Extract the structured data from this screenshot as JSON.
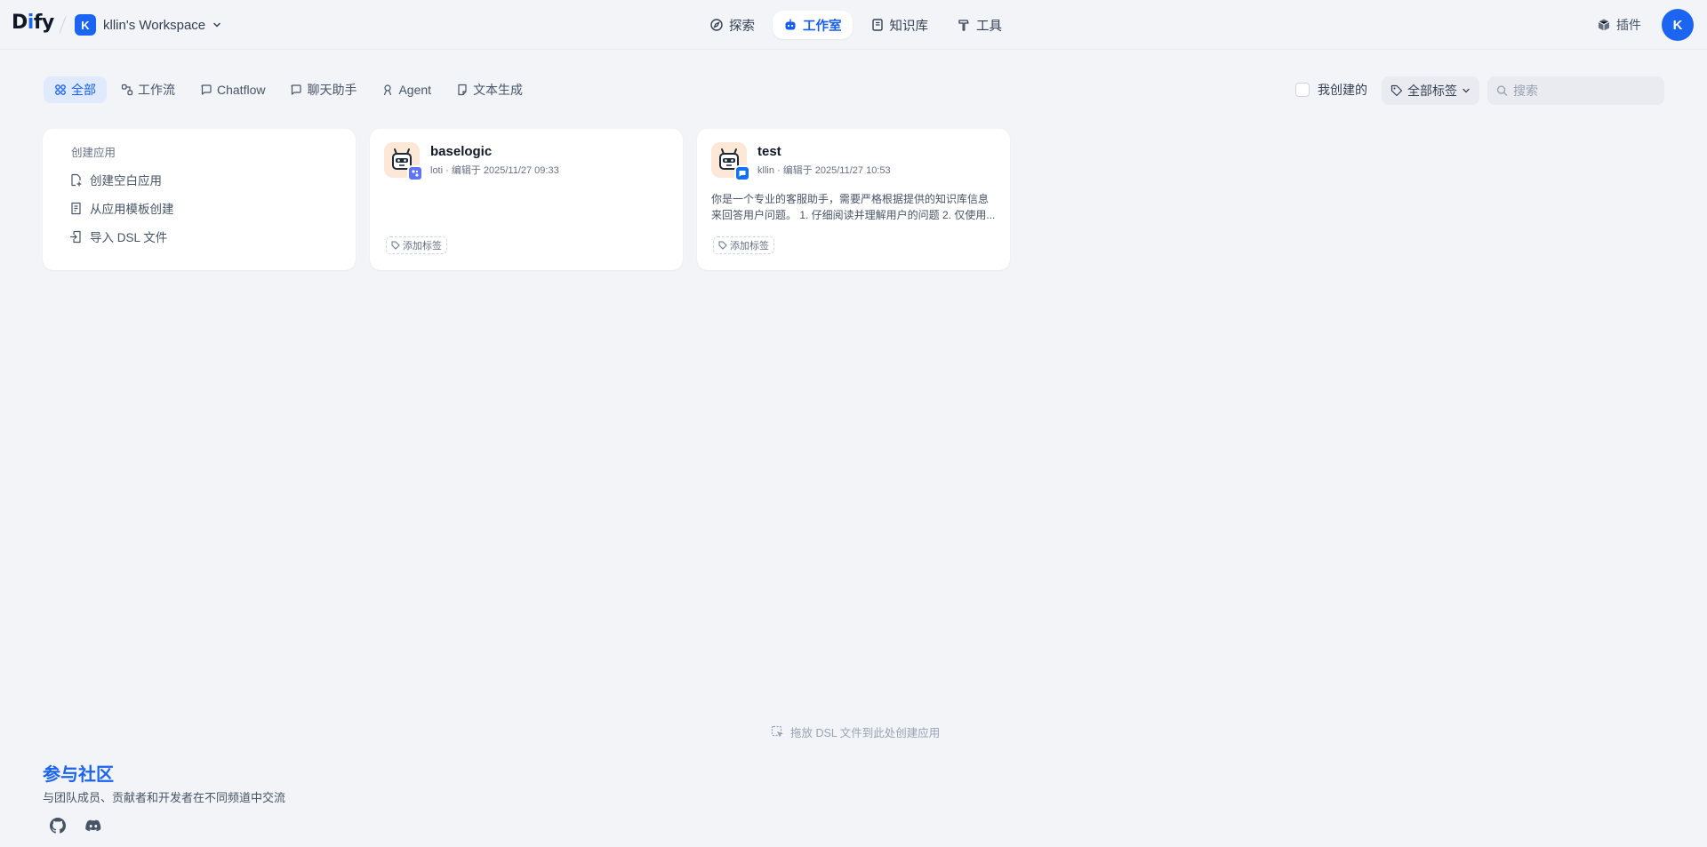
{
  "header": {
    "logo_text": "Dify",
    "workspace": {
      "initial": "K",
      "name": "kllin's Workspace"
    },
    "nav": [
      {
        "label": "探索",
        "icon": "compass-icon"
      },
      {
        "label": "工作室",
        "icon": "robot-icon",
        "active": true
      },
      {
        "label": "知识库",
        "icon": "book-icon"
      },
      {
        "label": "工具",
        "icon": "hammer-icon"
      }
    ],
    "plugin_label": "插件",
    "user_initial": "K"
  },
  "filters": {
    "tabs": [
      {
        "label": "全部",
        "icon": "grid-icon",
        "active": true
      },
      {
        "label": "工作流",
        "icon": "workflow-icon"
      },
      {
        "label": "Chatflow",
        "icon": "chat-bubble-icon"
      },
      {
        "label": "聊天助手",
        "icon": "chat-bubble-icon"
      },
      {
        "label": "Agent",
        "icon": "agent-icon"
      },
      {
        "label": "文本生成",
        "icon": "text-doc-icon"
      }
    ],
    "mine_label": "我创建的",
    "mine_checked": false,
    "tag_filter_label": "全部标签",
    "search_placeholder": "搜索",
    "search_value": ""
  },
  "create_card": {
    "title": "创建应用",
    "items": [
      {
        "label": "创建空白应用",
        "icon": "file-plus-icon"
      },
      {
        "label": "从应用模板创建",
        "icon": "template-icon"
      },
      {
        "label": "导入 DSL 文件",
        "icon": "import-file-icon"
      }
    ]
  },
  "apps": [
    {
      "name": "baselogic",
      "meta": "loti · 编辑于 2025/11/27 09:33",
      "description": "",
      "type": "workflow",
      "badge_color": "#6172f3",
      "tag_label": "添加标签"
    },
    {
      "name": "test",
      "meta": "kllin · 编辑于 2025/11/27 10:53",
      "description": "你是一个专业的客服助手，需要严格根据提供的知识库信息来回答用户问题。 1. 仔细阅读并理解用户的问题 2. 仅使用...",
      "type": "chat",
      "badge_color": "#1570ef",
      "tag_label": "添加标签"
    }
  ],
  "dropzone_text": "拖放 DSL 文件到此处创建应用",
  "community": {
    "title": "参与社区",
    "subtitle": "与团队成员、贡献者和开发者在不同频道中交流",
    "links": [
      {
        "icon": "github-icon"
      },
      {
        "icon": "discord-icon"
      }
    ]
  },
  "colors": {
    "accent": "#1c64f2",
    "background": "#f2f4f7",
    "app_icon_bg": "#fde8d7"
  }
}
